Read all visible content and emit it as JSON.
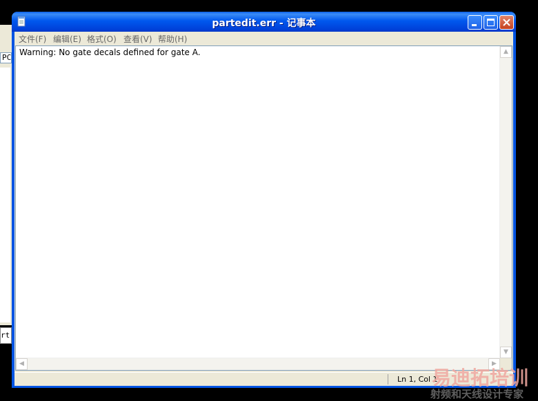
{
  "background_window": {
    "field_text": "PC",
    "button_text": "rt"
  },
  "window": {
    "title": "partedit.err - 记事本",
    "icon": "notepad-icon",
    "controls": {
      "minimize": "minimize-icon",
      "maximize": "maximize-icon",
      "close": "close-icon"
    }
  },
  "menu": {
    "items": [
      {
        "label": "文件(F)"
      },
      {
        "label": "编辑(E)"
      },
      {
        "label": "格式(O)"
      },
      {
        "label": "查看(V)"
      },
      {
        "label": "帮助(H)"
      }
    ]
  },
  "editor": {
    "content": "Warning: No gate decals defined for gate A."
  },
  "status": {
    "position": "Ln 1, Col 1"
  },
  "watermark": {
    "main": "易迪拓培训",
    "sub": "射频和天线设计专家"
  },
  "colors": {
    "titlebar": "#0058ee",
    "frame": "#0054e3",
    "chrome": "#ece9d8",
    "close_button": "#c6411e"
  }
}
